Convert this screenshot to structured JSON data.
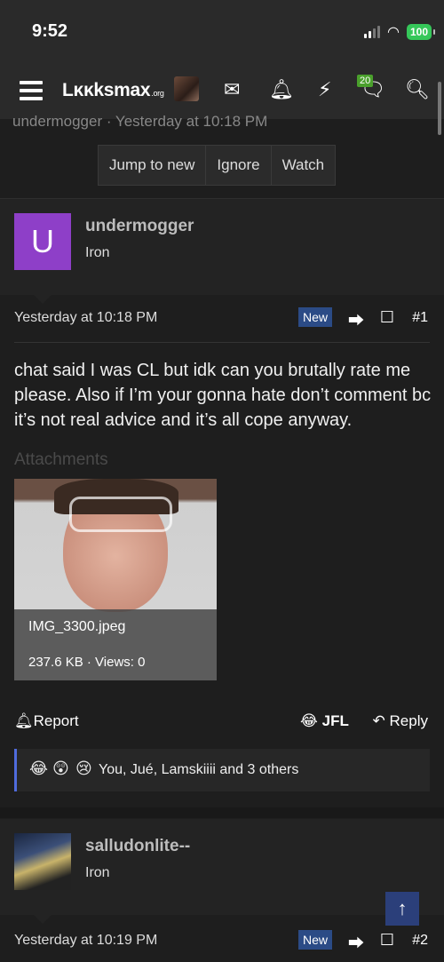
{
  "status": {
    "time": "9:52",
    "battery": "100"
  },
  "nav": {
    "logo": "Lκκksmax",
    "logo_suffix": ".org",
    "alerts_badge": "20"
  },
  "thread": {
    "meta": "undermogger · Yesterday at 10:18 PM",
    "buttons": [
      "Jump to new",
      "Ignore",
      "Watch"
    ]
  },
  "post1": {
    "avatar_letter": "U",
    "username": "undermogger",
    "rank": "Iron",
    "date": "Yesterday at 10:18 PM",
    "new_label": "New",
    "number": "#1",
    "body": "chat said I was CL but idk can you brutally rate me please. Also if I’m your gonna hate don’t comment bc it’s not real advice and it’s all cope anyway.",
    "attachments_label": "Attachments",
    "attachment": {
      "filename": "IMG_3300.jpeg",
      "info": "237.6 KB · Views: 0"
    },
    "report_label": "Report",
    "jfl_label": "JFL",
    "reply_label": "Reply",
    "reactions": {
      "emojis": [
        "😂",
        "😲",
        "😢"
      ],
      "text": "You, Jué, Lamskiiii and 3 others"
    }
  },
  "post2": {
    "username": "salludonlite--",
    "rank": "Iron",
    "date": "Yesterday at 10:19 PM",
    "new_label": "New",
    "number": "#2"
  },
  "colors": {
    "avatar_purple": "#8e3fc8",
    "new_badge": "#2b4b86",
    "accent_blue": "#4f6bdc",
    "badge_green": "#4aa02c"
  }
}
